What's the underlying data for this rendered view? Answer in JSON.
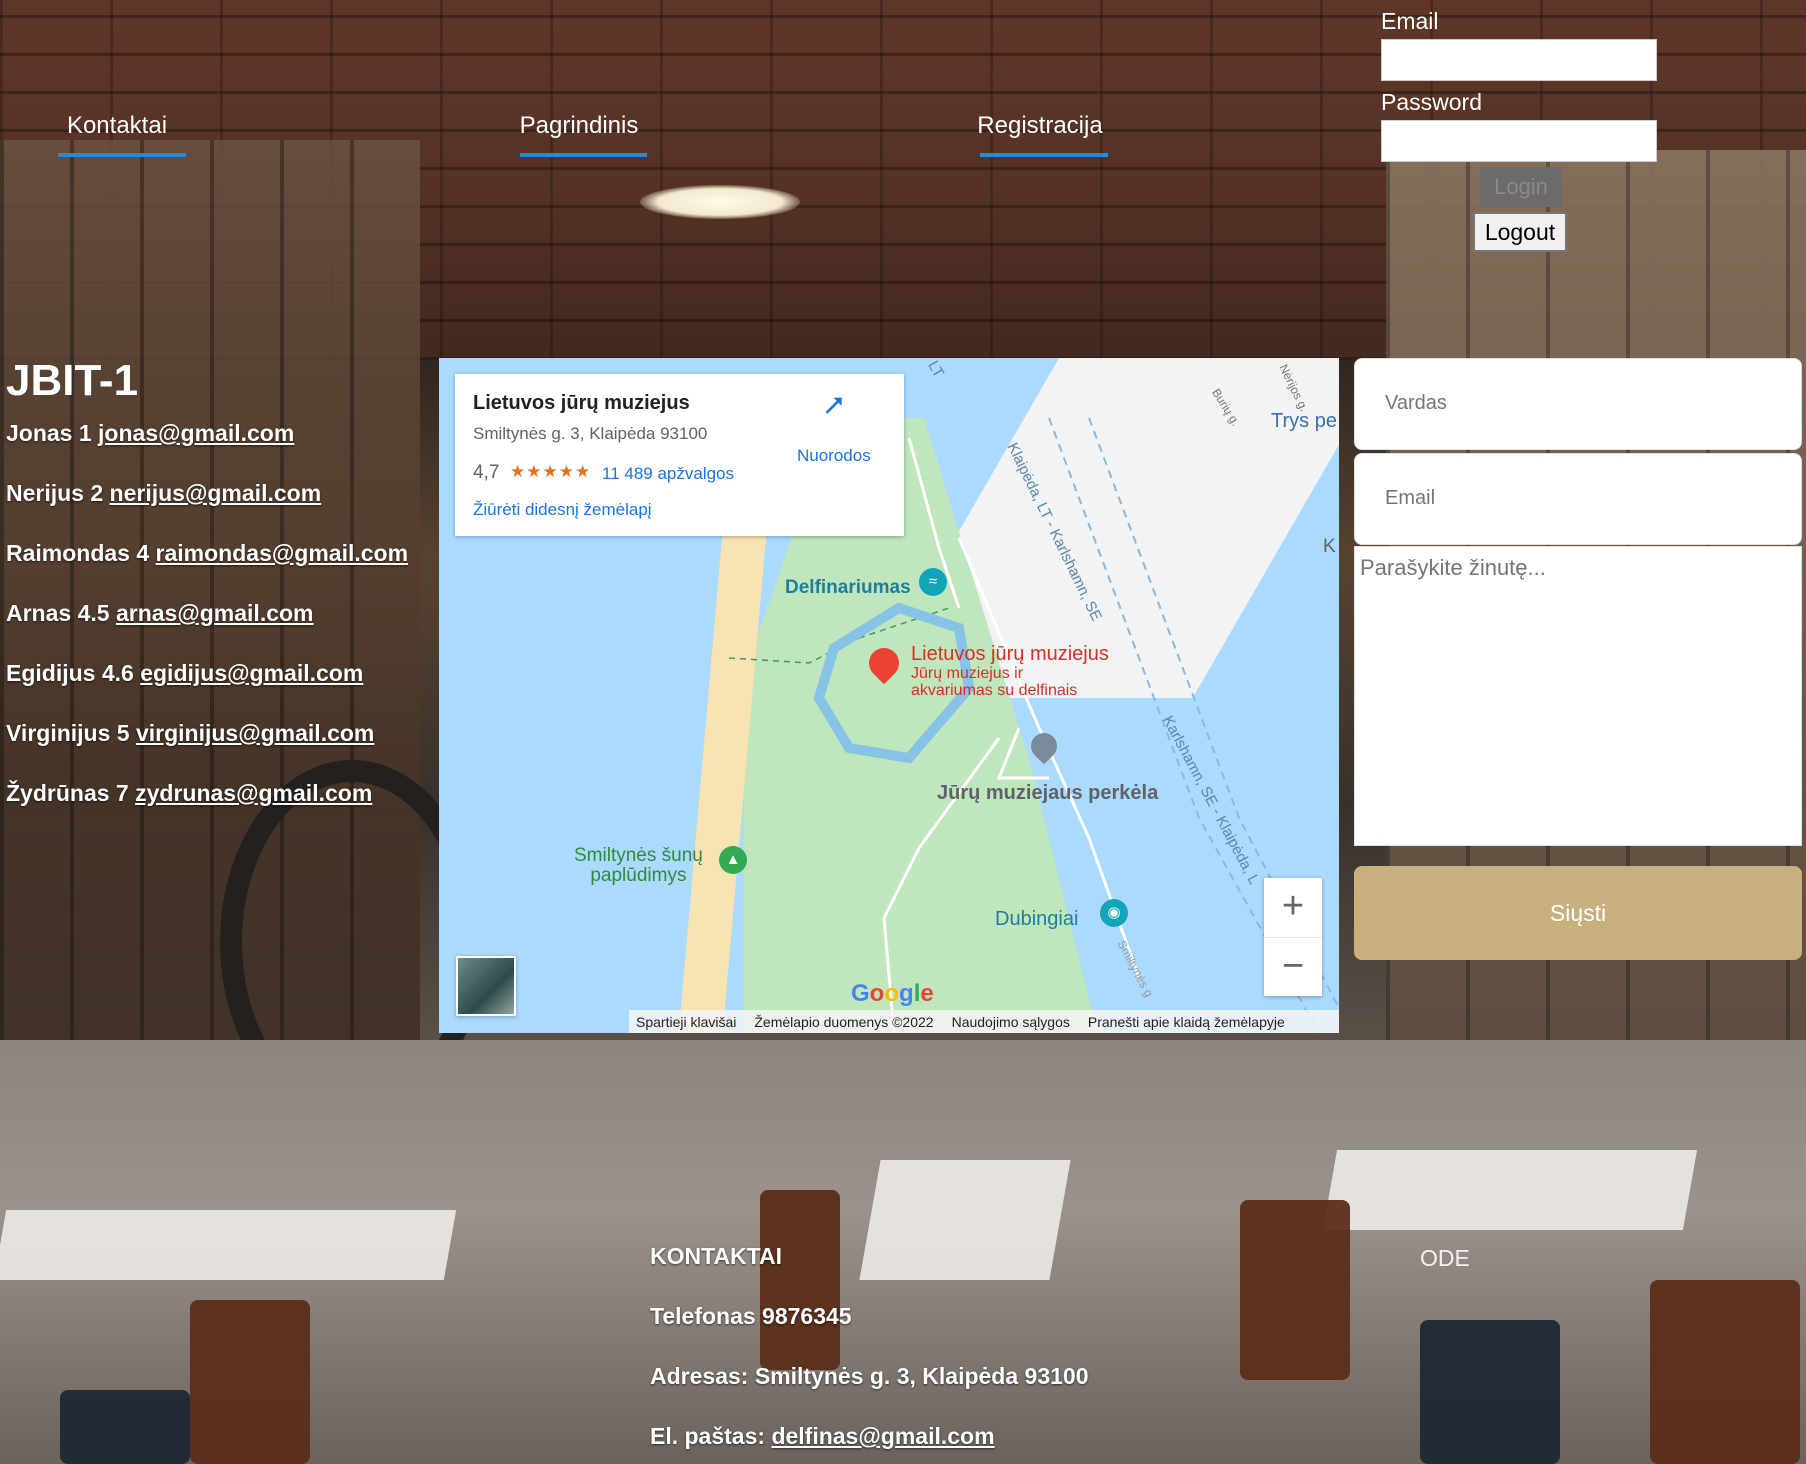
{
  "nav": {
    "items": [
      {
        "label": "Kontaktai"
      },
      {
        "label": "Pagrindinis"
      },
      {
        "label": "Registracija"
      }
    ]
  },
  "login": {
    "email_label": "Email",
    "password_label": "Password",
    "email_value": "",
    "password_value": "",
    "login_button": "Login",
    "logout_button": "Logout"
  },
  "team": {
    "title": "JBIT-1",
    "members": [
      {
        "text": "Jonas 1 ",
        "email": "jonas@gmail.com"
      },
      {
        "text": "Nerijus 2 ",
        "email": "nerijus@gmail.com"
      },
      {
        "text": "Raimondas 4 ",
        "email": "raimondas@gmail.com"
      },
      {
        "text": "Arnas 4.5 ",
        "email": "arnas@gmail.com"
      },
      {
        "text": "Egidijus 4.6 ",
        "email": "egidijus@gmail.com"
      },
      {
        "text": "Virginijus 5 ",
        "email": "virginijus@gmail.com"
      },
      {
        "text": "Žydrūnas 7 ",
        "email": "zydrunas@gmail.com"
      }
    ]
  },
  "map": {
    "place_title": "Lietuvos jūrų muziejus",
    "place_address": "Smiltynės g. 3, Klaipėda 93100",
    "rating": "4,7",
    "stars": "★★★★★",
    "reviews": "11 489 apžvalgos",
    "bigger_map": "Žiūrėti didesnį žemėlapį",
    "directions": "Nuorodos",
    "labels": {
      "delfinariumas": "Delfinariumas",
      "museum": "Lietuvos jūrų muziejus",
      "museum_sub_1": "Jūrų muziejus ir",
      "museum_sub_2": "akvariumas su delfinais",
      "perkela": "Jūrų muziejaus perkėla",
      "beach_1": "Smiltynės šunų",
      "beach_2": "paplūdimys",
      "dubingiai": "Dubingiai",
      "trys": "Trys pe",
      "road_1": "Klaipėda, LT - Karlshamn, SE",
      "road_2": "Karlshamn, SE - Klaipėda, L",
      "road_3": "Smiltynės g",
      "road_4": "Burių g.",
      "road_5": "Nėrijos g.",
      "lt": "LT",
      "k": "K"
    },
    "google": "Google",
    "footer": [
      "Spartieji klavišai",
      "Žemėlapio duomenys ©2022",
      "Naudojimo sąlygos",
      "Pranešti apie klaidą žemėlapyje"
    ],
    "zoom_in": "+",
    "zoom_out": "−"
  },
  "form": {
    "name_placeholder": "Vardas",
    "email_placeholder": "Email",
    "message_placeholder": "Parašykite žinutę...",
    "submit": "Siųsti"
  },
  "footer": {
    "title": "KONTAKTAI",
    "phone": "Telefonas 9876345",
    "address": "Adresas: Smiltynės g. 3, Klaipėda 93100",
    "email_label": "El. paštas: ",
    "email": "delfinas@gmail.com",
    "ode": "ODE"
  }
}
